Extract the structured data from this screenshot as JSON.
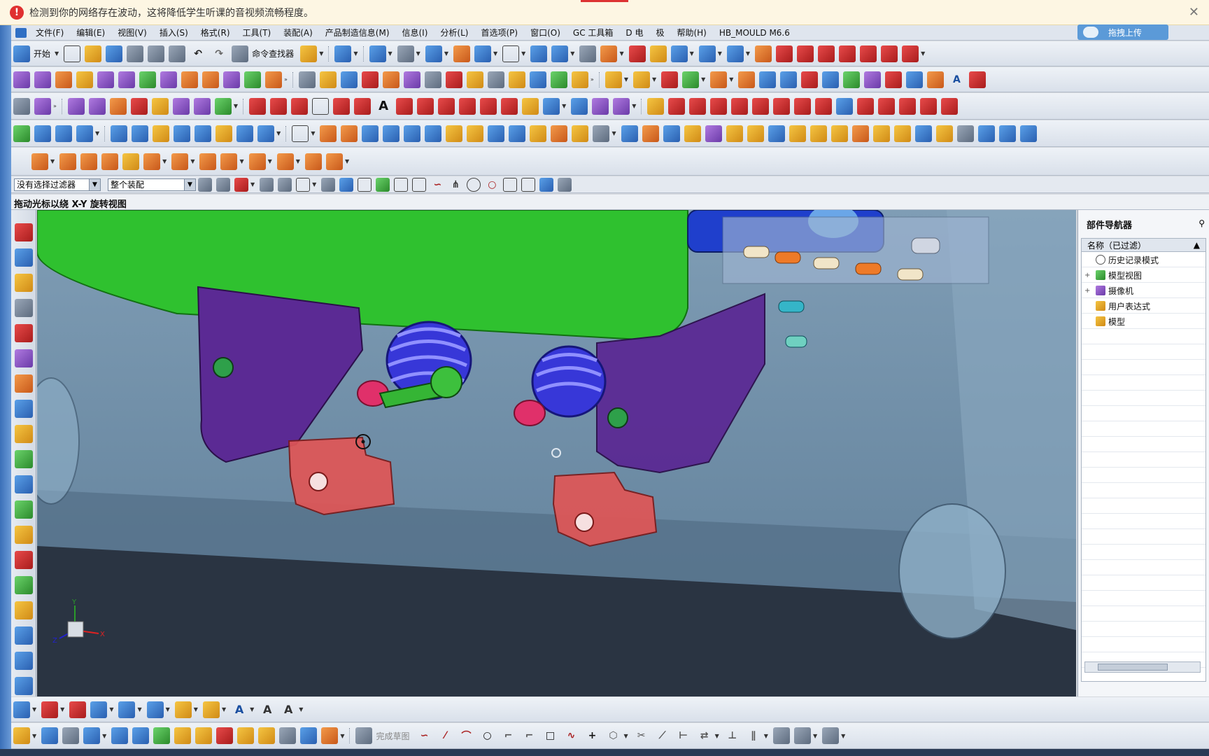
{
  "warning": {
    "text": "检测到你的网络存在波动，这将降低学生听课的音视频流畅程度。",
    "close": "✕"
  },
  "upload": {
    "label": "拖拽上传"
  },
  "menu": [
    "文件(F)",
    "编辑(E)",
    "视图(V)",
    "插入(S)",
    "格式(R)",
    "工具(T)",
    "装配(A)",
    "产品制造信息(M)",
    "信息(I)",
    "分析(L)",
    "首选项(P)",
    "窗口(O)",
    "GC 工具箱",
    "D 电",
    "极",
    "帮助(H)",
    "HB_MOULD M6.6"
  ],
  "toolbar": {
    "start_label": "开始",
    "cmd_finder_label": "命令查找器"
  },
  "filter": {
    "selection_filter": "没有选择过滤器",
    "assembly_scope": "整个装配"
  },
  "status": "拖动光标以绕 X-Y 旋转视图",
  "navigator": {
    "title": "部件导航器",
    "column": "名称（已过滤）",
    "items": [
      {
        "label": "历史记录模式",
        "expand": ""
      },
      {
        "label": "模型视图",
        "expand": "+"
      },
      {
        "label": "摄像机",
        "expand": "+"
      },
      {
        "label": "用户表达式",
        "expand": ""
      },
      {
        "label": "模型",
        "expand": ""
      }
    ]
  },
  "sketch": {
    "finish_label": "完成草图"
  },
  "axes": {
    "x": "X",
    "y": "Y",
    "z": "Z"
  }
}
